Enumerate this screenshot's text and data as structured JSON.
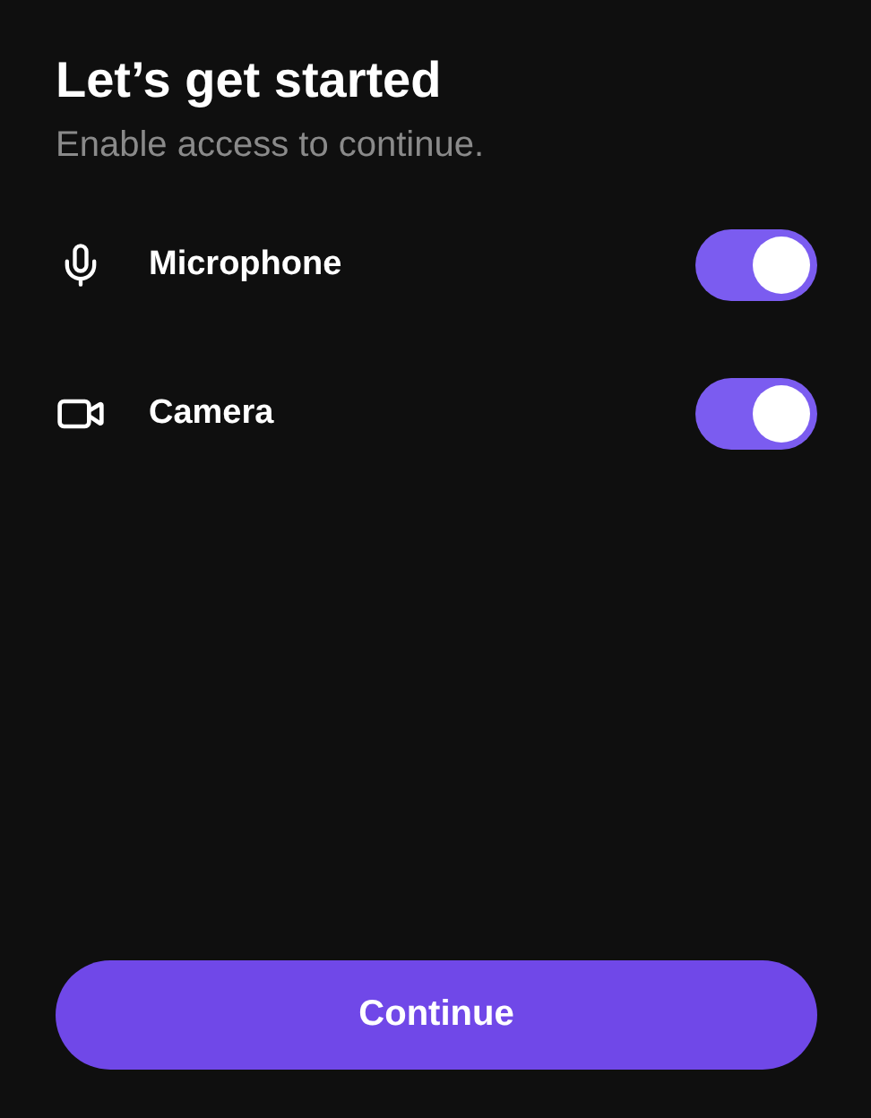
{
  "title": "Let’s get started",
  "subtitle": "Enable access to continue.",
  "permissions": [
    {
      "kind": "microphone",
      "label": "Microphone",
      "on": true
    },
    {
      "kind": "camera",
      "label": "Camera",
      "on": true
    }
  ],
  "button": "Continue"
}
